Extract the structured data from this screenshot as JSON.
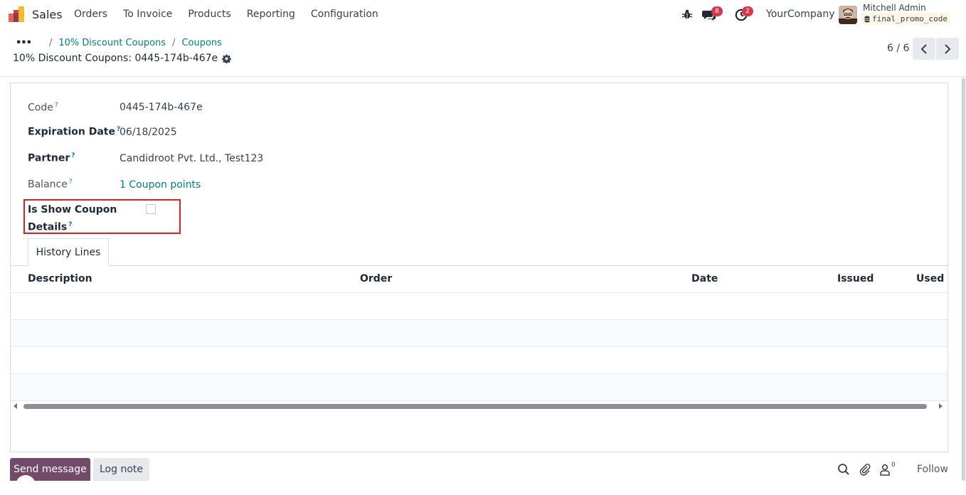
{
  "navbar": {
    "app_name": "Sales",
    "menu": [
      "Orders",
      "To Invoice",
      "Products",
      "Reporting",
      "Configuration"
    ],
    "messages_badge": "8",
    "activities_badge": "2",
    "company": "YourCompany",
    "user_name": "Mitchell Admin",
    "database": "final_promo_code"
  },
  "breadcrumb": {
    "items": [
      "10% Discount Coupons",
      "Coupons"
    ],
    "record_title": "10% Discount Coupons: 0445-174b-467e"
  },
  "pager": {
    "text": "6 / 6"
  },
  "form": {
    "code_label": "Code",
    "code_value": "0445-174b-467e",
    "expiration_label": "Expiration Date",
    "expiration_value": "06/18/2025",
    "partner_label": "Partner",
    "partner_value": "Candidroot Pvt. Ltd., Test123",
    "balance_label": "Balance",
    "balance_value": "1 Coupon points",
    "show_details_label_1": "Is Show Coupon",
    "show_details_label_2": "Details",
    "show_details_checked": false,
    "help_mark": "?"
  },
  "tabs": {
    "history": "History Lines"
  },
  "table": {
    "columns": [
      "Description",
      "Order",
      "Date",
      "Issued",
      "Used"
    ],
    "rows": []
  },
  "chatter": {
    "send_message": "Send message",
    "log_note": "Log note",
    "followers_count": "0",
    "follow": "Follow"
  }
}
